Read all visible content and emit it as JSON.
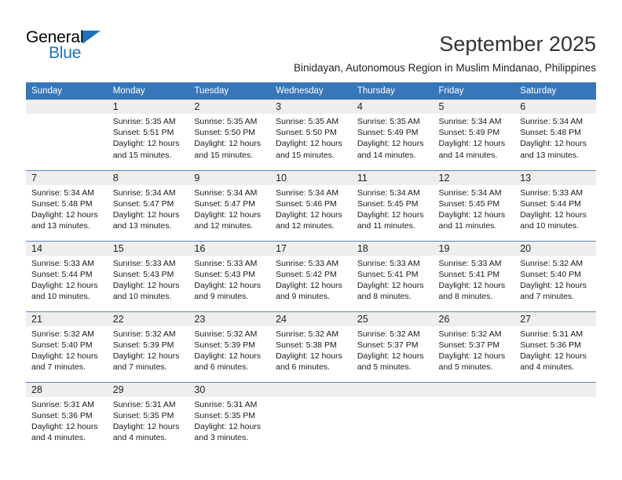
{
  "brand": {
    "name_primary": "General",
    "name_secondary": "Blue",
    "triangle_icon": "triangle-icon",
    "accent_color": "#1b72bb"
  },
  "header": {
    "month_title": "September 2025",
    "location": "Binidayan, Autonomous Region in Muslim Mindanao, Philippines"
  },
  "calendar": {
    "header_bg": "#3776b8",
    "daynum_bg": "#eeeeee",
    "weekday_headers": [
      "Sunday",
      "Monday",
      "Tuesday",
      "Wednesday",
      "Thursday",
      "Friday",
      "Saturday"
    ],
    "weeks": [
      [
        {
          "day": "",
          "lines": []
        },
        {
          "day": "1",
          "lines": [
            "Sunrise: 5:35 AM",
            "Sunset: 5:51 PM",
            "Daylight: 12 hours",
            "and 15 minutes."
          ]
        },
        {
          "day": "2",
          "lines": [
            "Sunrise: 5:35 AM",
            "Sunset: 5:50 PM",
            "Daylight: 12 hours",
            "and 15 minutes."
          ]
        },
        {
          "day": "3",
          "lines": [
            "Sunrise: 5:35 AM",
            "Sunset: 5:50 PM",
            "Daylight: 12 hours",
            "and 15 minutes."
          ]
        },
        {
          "day": "4",
          "lines": [
            "Sunrise: 5:35 AM",
            "Sunset: 5:49 PM",
            "Daylight: 12 hours",
            "and 14 minutes."
          ]
        },
        {
          "day": "5",
          "lines": [
            "Sunrise: 5:34 AM",
            "Sunset: 5:49 PM",
            "Daylight: 12 hours",
            "and 14 minutes."
          ]
        },
        {
          "day": "6",
          "lines": [
            "Sunrise: 5:34 AM",
            "Sunset: 5:48 PM",
            "Daylight: 12 hours",
            "and 13 minutes."
          ]
        }
      ],
      [
        {
          "day": "7",
          "lines": [
            "Sunrise: 5:34 AM",
            "Sunset: 5:48 PM",
            "Daylight: 12 hours",
            "and 13 minutes."
          ]
        },
        {
          "day": "8",
          "lines": [
            "Sunrise: 5:34 AM",
            "Sunset: 5:47 PM",
            "Daylight: 12 hours",
            "and 13 minutes."
          ]
        },
        {
          "day": "9",
          "lines": [
            "Sunrise: 5:34 AM",
            "Sunset: 5:47 PM",
            "Daylight: 12 hours",
            "and 12 minutes."
          ]
        },
        {
          "day": "10",
          "lines": [
            "Sunrise: 5:34 AM",
            "Sunset: 5:46 PM",
            "Daylight: 12 hours",
            "and 12 minutes."
          ]
        },
        {
          "day": "11",
          "lines": [
            "Sunrise: 5:34 AM",
            "Sunset: 5:45 PM",
            "Daylight: 12 hours",
            "and 11 minutes."
          ]
        },
        {
          "day": "12",
          "lines": [
            "Sunrise: 5:34 AM",
            "Sunset: 5:45 PM",
            "Daylight: 12 hours",
            "and 11 minutes."
          ]
        },
        {
          "day": "13",
          "lines": [
            "Sunrise: 5:33 AM",
            "Sunset: 5:44 PM",
            "Daylight: 12 hours",
            "and 10 minutes."
          ]
        }
      ],
      [
        {
          "day": "14",
          "lines": [
            "Sunrise: 5:33 AM",
            "Sunset: 5:44 PM",
            "Daylight: 12 hours",
            "and 10 minutes."
          ]
        },
        {
          "day": "15",
          "lines": [
            "Sunrise: 5:33 AM",
            "Sunset: 5:43 PM",
            "Daylight: 12 hours",
            "and 10 minutes."
          ]
        },
        {
          "day": "16",
          "lines": [
            "Sunrise: 5:33 AM",
            "Sunset: 5:43 PM",
            "Daylight: 12 hours",
            "and 9 minutes."
          ]
        },
        {
          "day": "17",
          "lines": [
            "Sunrise: 5:33 AM",
            "Sunset: 5:42 PM",
            "Daylight: 12 hours",
            "and 9 minutes."
          ]
        },
        {
          "day": "18",
          "lines": [
            "Sunrise: 5:33 AM",
            "Sunset: 5:41 PM",
            "Daylight: 12 hours",
            "and 8 minutes."
          ]
        },
        {
          "day": "19",
          "lines": [
            "Sunrise: 5:33 AM",
            "Sunset: 5:41 PM",
            "Daylight: 12 hours",
            "and 8 minutes."
          ]
        },
        {
          "day": "20",
          "lines": [
            "Sunrise: 5:32 AM",
            "Sunset: 5:40 PM",
            "Daylight: 12 hours",
            "and 7 minutes."
          ]
        }
      ],
      [
        {
          "day": "21",
          "lines": [
            "Sunrise: 5:32 AM",
            "Sunset: 5:40 PM",
            "Daylight: 12 hours",
            "and 7 minutes."
          ]
        },
        {
          "day": "22",
          "lines": [
            "Sunrise: 5:32 AM",
            "Sunset: 5:39 PM",
            "Daylight: 12 hours",
            "and 7 minutes."
          ]
        },
        {
          "day": "23",
          "lines": [
            "Sunrise: 5:32 AM",
            "Sunset: 5:39 PM",
            "Daylight: 12 hours",
            "and 6 minutes."
          ]
        },
        {
          "day": "24",
          "lines": [
            "Sunrise: 5:32 AM",
            "Sunset: 5:38 PM",
            "Daylight: 12 hours",
            "and 6 minutes."
          ]
        },
        {
          "day": "25",
          "lines": [
            "Sunrise: 5:32 AM",
            "Sunset: 5:37 PM",
            "Daylight: 12 hours",
            "and 5 minutes."
          ]
        },
        {
          "day": "26",
          "lines": [
            "Sunrise: 5:32 AM",
            "Sunset: 5:37 PM",
            "Daylight: 12 hours",
            "and 5 minutes."
          ]
        },
        {
          "day": "27",
          "lines": [
            "Sunrise: 5:31 AM",
            "Sunset: 5:36 PM",
            "Daylight: 12 hours",
            "and 4 minutes."
          ]
        }
      ],
      [
        {
          "day": "28",
          "lines": [
            "Sunrise: 5:31 AM",
            "Sunset: 5:36 PM",
            "Daylight: 12 hours",
            "and 4 minutes."
          ]
        },
        {
          "day": "29",
          "lines": [
            "Sunrise: 5:31 AM",
            "Sunset: 5:35 PM",
            "Daylight: 12 hours",
            "and 4 minutes."
          ]
        },
        {
          "day": "30",
          "lines": [
            "Sunrise: 5:31 AM",
            "Sunset: 5:35 PM",
            "Daylight: 12 hours",
            "and 3 minutes."
          ]
        },
        {
          "day": "",
          "lines": []
        },
        {
          "day": "",
          "lines": []
        },
        {
          "day": "",
          "lines": []
        },
        {
          "day": "",
          "lines": []
        }
      ]
    ]
  }
}
